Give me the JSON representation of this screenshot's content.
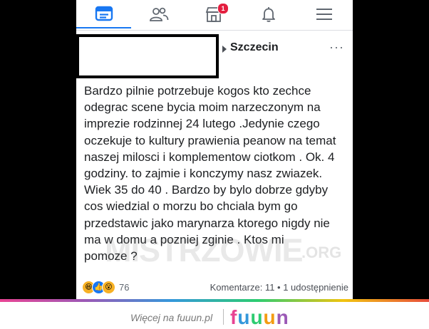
{
  "tabs": [
    {
      "icon": "feed-icon",
      "active": true
    },
    {
      "icon": "friends-icon"
    },
    {
      "icon": "marketplace-icon",
      "badge": "1"
    },
    {
      "icon": "bell-icon"
    },
    {
      "icon": "menu-icon"
    }
  ],
  "post": {
    "location": "Szczecin",
    "more": "···",
    "lines": [
      "Bardzo pilnie potrzebuje kogos kto zechce",
      "odegrac scene bycia moim narzeczonym na",
      "imprezie rodzinnej 24 lutego .Jedynie czego",
      "oczekuje to kultury prawienia peanow na temat",
      "naszej milosci i komplementow ciotkom . Ok. 4",
      "godziny. to zajmie i konczymy nasz zwiazek.",
      "Wiek 35 do 40 . Bardzo by bylo dobrze gdyby",
      "cos wiedzial o morzu bo chciala bym go",
      "przedstawic jako marynarza ktorego nigdy nie",
      "ma w domu a pozniej zginie . Ktos mi",
      "pomoze ?"
    ],
    "reaction_count": "76",
    "stats": "Komentarze: 11 • 1 udostępnienie"
  },
  "watermark": {
    "main": "MISTRZOWIE",
    "suffix": ".ORG"
  },
  "footer": {
    "text": "Więcej na fuuun.pl",
    "logo": [
      "f",
      "u",
      "u",
      "u",
      "n"
    ]
  },
  "colors": {
    "accent": "#1877f2",
    "badge": "#e41e3f"
  }
}
